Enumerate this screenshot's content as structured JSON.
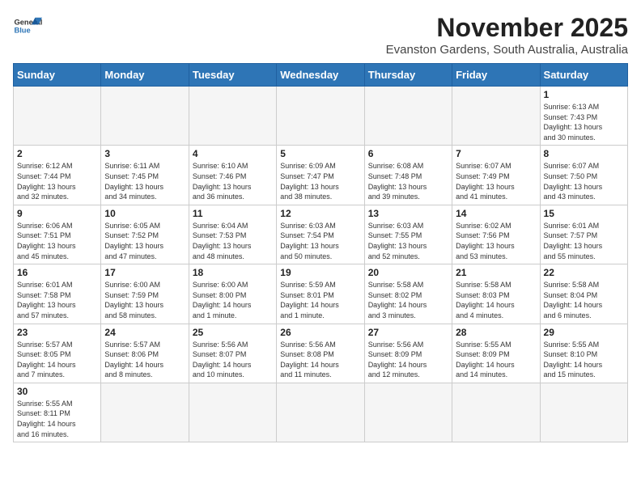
{
  "header": {
    "logo_line1": "General",
    "logo_line2": "Blue",
    "month": "November 2025",
    "location": "Evanston Gardens, South Australia, Australia"
  },
  "weekdays": [
    "Sunday",
    "Monday",
    "Tuesday",
    "Wednesday",
    "Thursday",
    "Friday",
    "Saturday"
  ],
  "weeks": [
    [
      {
        "day": "",
        "info": ""
      },
      {
        "day": "",
        "info": ""
      },
      {
        "day": "",
        "info": ""
      },
      {
        "day": "",
        "info": ""
      },
      {
        "day": "",
        "info": ""
      },
      {
        "day": "",
        "info": ""
      },
      {
        "day": "1",
        "info": "Sunrise: 6:13 AM\nSunset: 7:43 PM\nDaylight: 13 hours\nand 30 minutes."
      }
    ],
    [
      {
        "day": "2",
        "info": "Sunrise: 6:12 AM\nSunset: 7:44 PM\nDaylight: 13 hours\nand 32 minutes."
      },
      {
        "day": "3",
        "info": "Sunrise: 6:11 AM\nSunset: 7:45 PM\nDaylight: 13 hours\nand 34 minutes."
      },
      {
        "day": "4",
        "info": "Sunrise: 6:10 AM\nSunset: 7:46 PM\nDaylight: 13 hours\nand 36 minutes."
      },
      {
        "day": "5",
        "info": "Sunrise: 6:09 AM\nSunset: 7:47 PM\nDaylight: 13 hours\nand 38 minutes."
      },
      {
        "day": "6",
        "info": "Sunrise: 6:08 AM\nSunset: 7:48 PM\nDaylight: 13 hours\nand 39 minutes."
      },
      {
        "day": "7",
        "info": "Sunrise: 6:07 AM\nSunset: 7:49 PM\nDaylight: 13 hours\nand 41 minutes."
      },
      {
        "day": "8",
        "info": "Sunrise: 6:07 AM\nSunset: 7:50 PM\nDaylight: 13 hours\nand 43 minutes."
      }
    ],
    [
      {
        "day": "9",
        "info": "Sunrise: 6:06 AM\nSunset: 7:51 PM\nDaylight: 13 hours\nand 45 minutes."
      },
      {
        "day": "10",
        "info": "Sunrise: 6:05 AM\nSunset: 7:52 PM\nDaylight: 13 hours\nand 47 minutes."
      },
      {
        "day": "11",
        "info": "Sunrise: 6:04 AM\nSunset: 7:53 PM\nDaylight: 13 hours\nand 48 minutes."
      },
      {
        "day": "12",
        "info": "Sunrise: 6:03 AM\nSunset: 7:54 PM\nDaylight: 13 hours\nand 50 minutes."
      },
      {
        "day": "13",
        "info": "Sunrise: 6:03 AM\nSunset: 7:55 PM\nDaylight: 13 hours\nand 52 minutes."
      },
      {
        "day": "14",
        "info": "Sunrise: 6:02 AM\nSunset: 7:56 PM\nDaylight: 13 hours\nand 53 minutes."
      },
      {
        "day": "15",
        "info": "Sunrise: 6:01 AM\nSunset: 7:57 PM\nDaylight: 13 hours\nand 55 minutes."
      }
    ],
    [
      {
        "day": "16",
        "info": "Sunrise: 6:01 AM\nSunset: 7:58 PM\nDaylight: 13 hours\nand 57 minutes."
      },
      {
        "day": "17",
        "info": "Sunrise: 6:00 AM\nSunset: 7:59 PM\nDaylight: 13 hours\nand 58 minutes."
      },
      {
        "day": "18",
        "info": "Sunrise: 6:00 AM\nSunset: 8:00 PM\nDaylight: 14 hours\nand 1 minute."
      },
      {
        "day": "19",
        "info": "Sunrise: 5:59 AM\nSunset: 8:01 PM\nDaylight: 14 hours\nand 1 minute."
      },
      {
        "day": "20",
        "info": "Sunrise: 5:58 AM\nSunset: 8:02 PM\nDaylight: 14 hours\nand 3 minutes."
      },
      {
        "day": "21",
        "info": "Sunrise: 5:58 AM\nSunset: 8:03 PM\nDaylight: 14 hours\nand 4 minutes."
      },
      {
        "day": "22",
        "info": "Sunrise: 5:58 AM\nSunset: 8:04 PM\nDaylight: 14 hours\nand 6 minutes."
      }
    ],
    [
      {
        "day": "23",
        "info": "Sunrise: 5:57 AM\nSunset: 8:05 PM\nDaylight: 14 hours\nand 7 minutes."
      },
      {
        "day": "24",
        "info": "Sunrise: 5:57 AM\nSunset: 8:06 PM\nDaylight: 14 hours\nand 8 minutes."
      },
      {
        "day": "25",
        "info": "Sunrise: 5:56 AM\nSunset: 8:07 PM\nDaylight: 14 hours\nand 10 minutes."
      },
      {
        "day": "26",
        "info": "Sunrise: 5:56 AM\nSunset: 8:08 PM\nDaylight: 14 hours\nand 11 minutes."
      },
      {
        "day": "27",
        "info": "Sunrise: 5:56 AM\nSunset: 8:09 PM\nDaylight: 14 hours\nand 12 minutes."
      },
      {
        "day": "28",
        "info": "Sunrise: 5:55 AM\nSunset: 8:09 PM\nDaylight: 14 hours\nand 14 minutes."
      },
      {
        "day": "29",
        "info": "Sunrise: 5:55 AM\nSunset: 8:10 PM\nDaylight: 14 hours\nand 15 minutes."
      }
    ],
    [
      {
        "day": "30",
        "info": "Sunrise: 5:55 AM\nSunset: 8:11 PM\nDaylight: 14 hours\nand 16 minutes."
      },
      {
        "day": "",
        "info": ""
      },
      {
        "day": "",
        "info": ""
      },
      {
        "day": "",
        "info": ""
      },
      {
        "day": "",
        "info": ""
      },
      {
        "day": "",
        "info": ""
      },
      {
        "day": "",
        "info": ""
      }
    ]
  ]
}
